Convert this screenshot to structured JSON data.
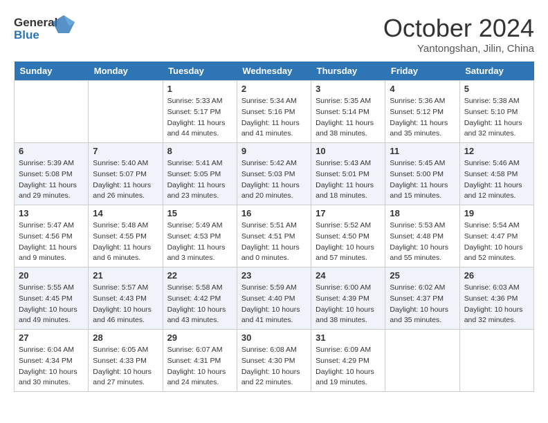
{
  "header": {
    "logo_line1": "General",
    "logo_line2": "Blue",
    "month": "October 2024",
    "location": "Yantongshan, Jilin, China"
  },
  "weekdays": [
    "Sunday",
    "Monday",
    "Tuesday",
    "Wednesday",
    "Thursday",
    "Friday",
    "Saturday"
  ],
  "weeks": [
    {
      "days": [
        {
          "num": "",
          "info": ""
        },
        {
          "num": "",
          "info": ""
        },
        {
          "num": "1",
          "info": "Sunrise: 5:33 AM\nSunset: 5:17 PM\nDaylight: 11 hours and 44 minutes."
        },
        {
          "num": "2",
          "info": "Sunrise: 5:34 AM\nSunset: 5:16 PM\nDaylight: 11 hours and 41 minutes."
        },
        {
          "num": "3",
          "info": "Sunrise: 5:35 AM\nSunset: 5:14 PM\nDaylight: 11 hours and 38 minutes."
        },
        {
          "num": "4",
          "info": "Sunrise: 5:36 AM\nSunset: 5:12 PM\nDaylight: 11 hours and 35 minutes."
        },
        {
          "num": "5",
          "info": "Sunrise: 5:38 AM\nSunset: 5:10 PM\nDaylight: 11 hours and 32 minutes."
        }
      ]
    },
    {
      "days": [
        {
          "num": "6",
          "info": "Sunrise: 5:39 AM\nSunset: 5:08 PM\nDaylight: 11 hours and 29 minutes."
        },
        {
          "num": "7",
          "info": "Sunrise: 5:40 AM\nSunset: 5:07 PM\nDaylight: 11 hours and 26 minutes."
        },
        {
          "num": "8",
          "info": "Sunrise: 5:41 AM\nSunset: 5:05 PM\nDaylight: 11 hours and 23 minutes."
        },
        {
          "num": "9",
          "info": "Sunrise: 5:42 AM\nSunset: 5:03 PM\nDaylight: 11 hours and 20 minutes."
        },
        {
          "num": "10",
          "info": "Sunrise: 5:43 AM\nSunset: 5:01 PM\nDaylight: 11 hours and 18 minutes."
        },
        {
          "num": "11",
          "info": "Sunrise: 5:45 AM\nSunset: 5:00 PM\nDaylight: 11 hours and 15 minutes."
        },
        {
          "num": "12",
          "info": "Sunrise: 5:46 AM\nSunset: 4:58 PM\nDaylight: 11 hours and 12 minutes."
        }
      ]
    },
    {
      "days": [
        {
          "num": "13",
          "info": "Sunrise: 5:47 AM\nSunset: 4:56 PM\nDaylight: 11 hours and 9 minutes."
        },
        {
          "num": "14",
          "info": "Sunrise: 5:48 AM\nSunset: 4:55 PM\nDaylight: 11 hours and 6 minutes."
        },
        {
          "num": "15",
          "info": "Sunrise: 5:49 AM\nSunset: 4:53 PM\nDaylight: 11 hours and 3 minutes."
        },
        {
          "num": "16",
          "info": "Sunrise: 5:51 AM\nSunset: 4:51 PM\nDaylight: 11 hours and 0 minutes."
        },
        {
          "num": "17",
          "info": "Sunrise: 5:52 AM\nSunset: 4:50 PM\nDaylight: 10 hours and 57 minutes."
        },
        {
          "num": "18",
          "info": "Sunrise: 5:53 AM\nSunset: 4:48 PM\nDaylight: 10 hours and 55 minutes."
        },
        {
          "num": "19",
          "info": "Sunrise: 5:54 AM\nSunset: 4:47 PM\nDaylight: 10 hours and 52 minutes."
        }
      ]
    },
    {
      "days": [
        {
          "num": "20",
          "info": "Sunrise: 5:55 AM\nSunset: 4:45 PM\nDaylight: 10 hours and 49 minutes."
        },
        {
          "num": "21",
          "info": "Sunrise: 5:57 AM\nSunset: 4:43 PM\nDaylight: 10 hours and 46 minutes."
        },
        {
          "num": "22",
          "info": "Sunrise: 5:58 AM\nSunset: 4:42 PM\nDaylight: 10 hours and 43 minutes."
        },
        {
          "num": "23",
          "info": "Sunrise: 5:59 AM\nSunset: 4:40 PM\nDaylight: 10 hours and 41 minutes."
        },
        {
          "num": "24",
          "info": "Sunrise: 6:00 AM\nSunset: 4:39 PM\nDaylight: 10 hours and 38 minutes."
        },
        {
          "num": "25",
          "info": "Sunrise: 6:02 AM\nSunset: 4:37 PM\nDaylight: 10 hours and 35 minutes."
        },
        {
          "num": "26",
          "info": "Sunrise: 6:03 AM\nSunset: 4:36 PM\nDaylight: 10 hours and 32 minutes."
        }
      ]
    },
    {
      "days": [
        {
          "num": "27",
          "info": "Sunrise: 6:04 AM\nSunset: 4:34 PM\nDaylight: 10 hours and 30 minutes."
        },
        {
          "num": "28",
          "info": "Sunrise: 6:05 AM\nSunset: 4:33 PM\nDaylight: 10 hours and 27 minutes."
        },
        {
          "num": "29",
          "info": "Sunrise: 6:07 AM\nSunset: 4:31 PM\nDaylight: 10 hours and 24 minutes."
        },
        {
          "num": "30",
          "info": "Sunrise: 6:08 AM\nSunset: 4:30 PM\nDaylight: 10 hours and 22 minutes."
        },
        {
          "num": "31",
          "info": "Sunrise: 6:09 AM\nSunset: 4:29 PM\nDaylight: 10 hours and 19 minutes."
        },
        {
          "num": "",
          "info": ""
        },
        {
          "num": "",
          "info": ""
        }
      ]
    }
  ]
}
